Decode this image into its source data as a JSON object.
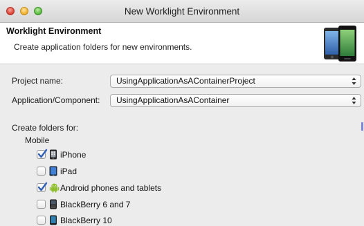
{
  "window": {
    "title": "New Worklight Environment"
  },
  "banner": {
    "title": "Worklight Environment",
    "description": "Create application folders for new environments."
  },
  "form": {
    "project_label": "Project name:",
    "project_value": "UsingApplicationAsAContainerProject",
    "app_label": "Application/Component:",
    "app_value": "UsingApplicationAsAContainer"
  },
  "folders": {
    "section_label": "Create folders for:",
    "group_label": "Mobile",
    "items": [
      {
        "label": "iPhone",
        "checked": true,
        "icon": "iphone-icon"
      },
      {
        "label": "iPad",
        "checked": false,
        "icon": "ipad-icon"
      },
      {
        "label": "Android phones and tablets",
        "checked": true,
        "icon": "android-icon"
      },
      {
        "label": "BlackBerry 6 and 7",
        "checked": false,
        "icon": "blackberry-icon"
      },
      {
        "label": "BlackBerry 10",
        "checked": false,
        "icon": "blackberry10-icon"
      }
    ]
  },
  "colors": {
    "accent": "#3b6fd6",
    "banner_bg": "#ffffff",
    "window_bg": "#ececec"
  }
}
